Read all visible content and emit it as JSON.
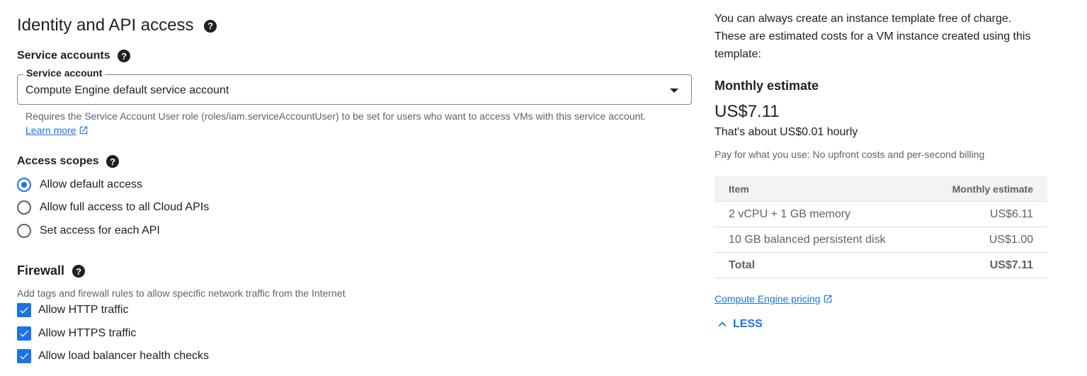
{
  "identity": {
    "title": "Identity and API access",
    "service_accounts_label": "Service accounts",
    "service_account_field_label": "Service account",
    "service_account_value": "Compute Engine default service account",
    "helper_text": "Requires the Service Account User role (roles/iam.serviceAccountUser) to be set for users who want to access VMs with this service account.",
    "learn_more": "Learn more",
    "access_scopes_label": "Access scopes",
    "scopes": [
      {
        "label": "Allow default access",
        "selected": true
      },
      {
        "label": "Allow full access to all Cloud APIs",
        "selected": false
      },
      {
        "label": "Set access for each API",
        "selected": false
      }
    ]
  },
  "firewall": {
    "title": "Firewall",
    "description": "Add tags and firewall rules to allow specific network traffic from the Internet",
    "options": [
      {
        "label": "Allow HTTP traffic",
        "checked": true
      },
      {
        "label": "Allow HTTPS traffic",
        "checked": true
      },
      {
        "label": "Allow load balancer health checks",
        "checked": true
      }
    ]
  },
  "pricing": {
    "intro_line1": "You can always create an instance template free of charge.",
    "intro_line2": "These are estimated costs for a VM instance created using this",
    "intro_line3": "template:",
    "monthly_label": "Monthly estimate",
    "monthly_value": "US$7.11",
    "hourly": "That's about US$0.01 hourly",
    "billing_note": "Pay for what you use: No upfront costs and per-second billing",
    "table": {
      "headers": [
        "Item",
        "Monthly estimate"
      ],
      "rows": [
        {
          "item": "2 vCPU + 1 GB memory",
          "cost": "US$6.11"
        },
        {
          "item": "10 GB balanced persistent disk",
          "cost": "US$1.00"
        }
      ],
      "total_label": "Total",
      "total_value": "US$7.11"
    },
    "pricing_link": "Compute Engine pricing",
    "less_button": "LESS"
  },
  "colors": {
    "accent": "#1a73e8",
    "text": "#202124",
    "muted": "#5f6368"
  }
}
